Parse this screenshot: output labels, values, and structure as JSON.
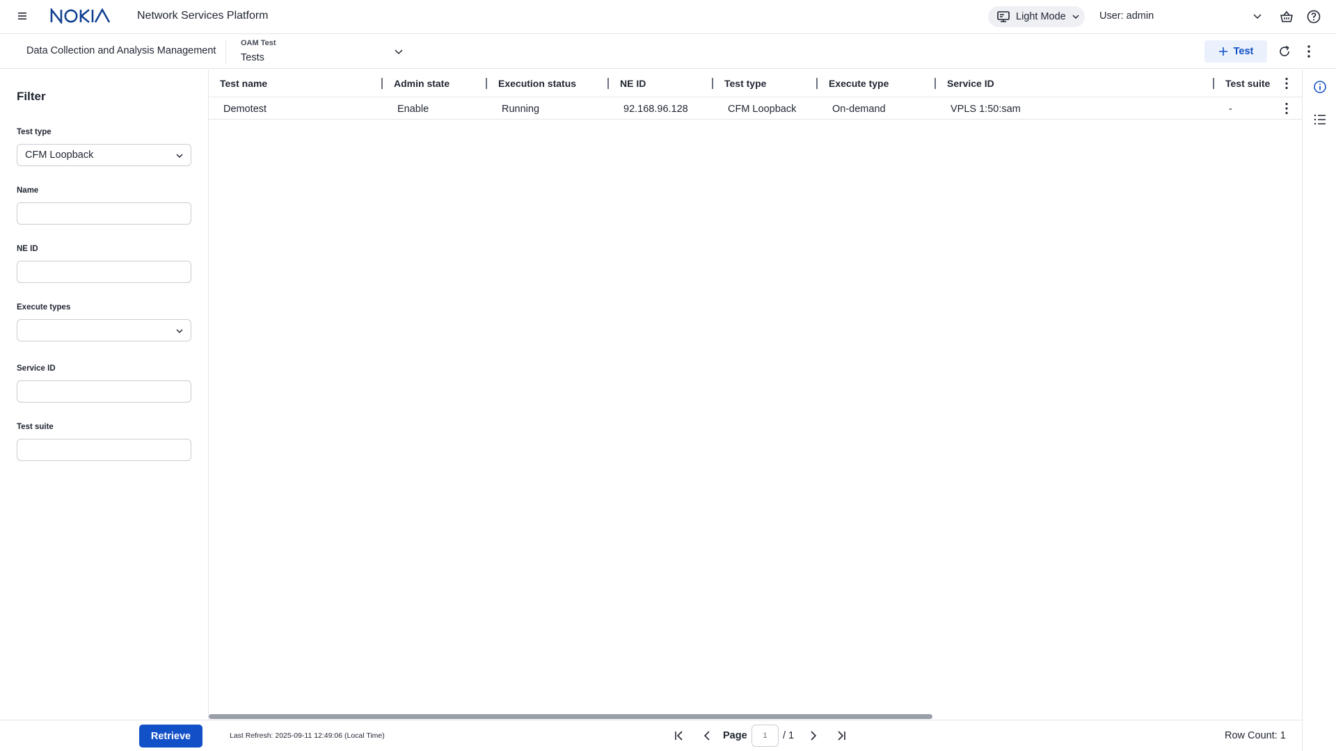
{
  "header": {
    "brand": "NOKIA",
    "app_title": "Network Services Platform",
    "mode_label": "Light Mode",
    "user_label": "User: admin"
  },
  "subbar": {
    "app_name": "Data Collection and Analysis Management",
    "context_label": "OAM Test",
    "page_label": "Tests",
    "add_button_label": "Test"
  },
  "filter": {
    "title": "Filter",
    "fields": [
      {
        "label": "Test type",
        "value": "CFM Loopback"
      },
      {
        "label": "Name",
        "value": ""
      },
      {
        "label": "NE ID",
        "value": ""
      },
      {
        "label": "Execute types",
        "value": ""
      },
      {
        "label": "Service ID",
        "value": ""
      },
      {
        "label": "Test suite",
        "value": ""
      }
    ]
  },
  "table": {
    "columns": [
      "Test name",
      "Admin state",
      "Execution status",
      "NE ID",
      "Test type",
      "Execute type",
      "Service ID",
      "Test suite"
    ],
    "rows": [
      [
        "Demotest",
        "Enable",
        "Running",
        "92.168.96.128",
        "CFM Loopback",
        "On-demand",
        "VPLS 1:50:sam",
        "-"
      ]
    ]
  },
  "footer": {
    "retrieve_label": "Retrieve",
    "last_refresh": "Last Refresh: 2025-09-11 12:49:06 (Local Time)",
    "page_label": "Page",
    "page_current": "1",
    "page_total": "/ 1",
    "row_count": "Row Count: 1"
  },
  "colors": {
    "brand_blue": "#124191",
    "primary": "#1250c7",
    "accent_bg": "#eaf1fd",
    "border": "#e3e5ea"
  }
}
